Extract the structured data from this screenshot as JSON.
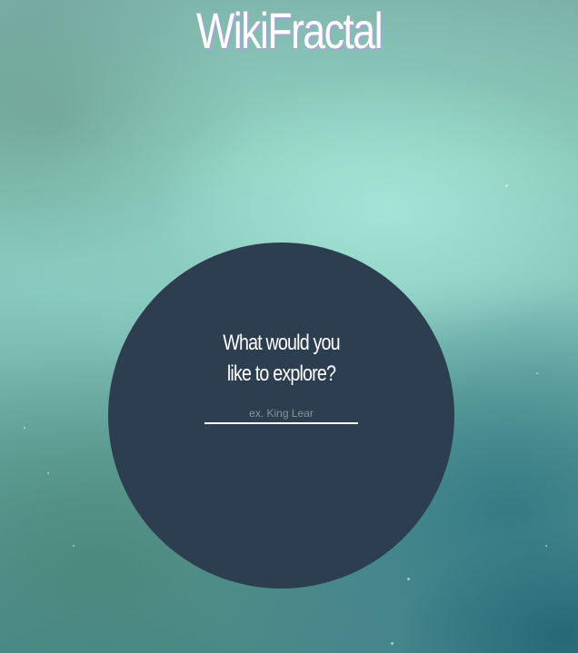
{
  "header": {
    "title": "WikiFractal"
  },
  "explore": {
    "prompt_line1": "What would you",
    "prompt_line2": "like to explore?",
    "search_value": "",
    "search_placeholder": "ex. King Lear"
  },
  "colors": {
    "circle": "#2d3e50",
    "title_text": "#ffffff",
    "title_shadow": "#a9a3d6",
    "input_underline": "#ffffff",
    "placeholder": "#8a949e"
  }
}
